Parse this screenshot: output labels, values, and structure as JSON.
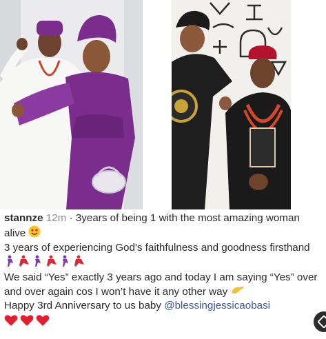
{
  "post": {
    "username": "stannze",
    "time": "12m",
    "line1": "3years of being 1 with the most amazing woman alive",
    "line2": "3 years of experiencing God's faithfulness and goodness firsthand",
    "line3": "We said “Yes” exactly 3 years ago and today I am saying “Yes” over and over again cos I won’t have it any other way",
    "line4": "Happy 3rd Anniversary to us baby",
    "mention": "@blessingjessicaobasi"
  },
  "icons": {
    "smile": "heart-eyes-emoji",
    "dancers": [
      "man-dancing-emoji",
      "woman-dancing-emoji",
      "man-dancing-emoji",
      "woman-dancing-emoji",
      "man-dancing-emoji",
      "woman-dancing-emoji"
    ],
    "hand": "pinching-hand-emoji",
    "hearts": [
      "red-heart-emoji",
      "red-heart-emoji",
      "red-heart-emoji"
    ]
  },
  "colors": {
    "mention": "#385898",
    "heart": "#e0202e",
    "purple": "#7b2d8e",
    "cap": "#b5122e"
  }
}
